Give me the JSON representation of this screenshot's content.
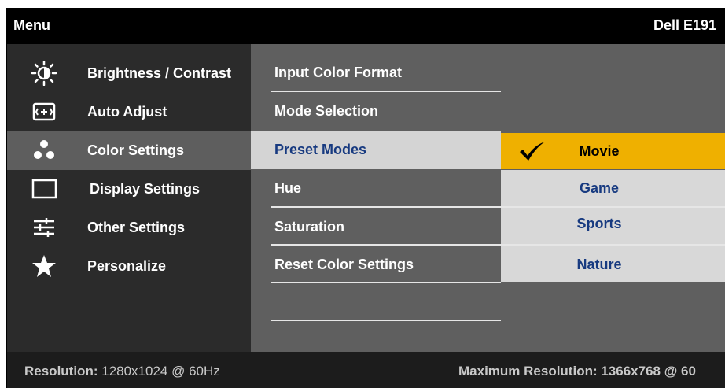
{
  "header": {
    "menu_title": "Menu",
    "model": "Dell E191"
  },
  "left_menu": [
    {
      "label": "Brightness / Contrast",
      "icon": "brightness-icon"
    },
    {
      "label": "Auto Adjust",
      "icon": "auto-adjust-icon"
    },
    {
      "label": "Color Settings",
      "icon": "color-settings-icon",
      "selected": true
    },
    {
      "label": "Display Settings",
      "icon": "display-icon"
    },
    {
      "label": "Other Settings",
      "icon": "sliders-icon"
    },
    {
      "label": "Personalize",
      "icon": "star-icon"
    }
  ],
  "color_menu": [
    {
      "label": "Input Color Format"
    },
    {
      "label": "Mode Selection"
    },
    {
      "label": "Preset Modes",
      "selected": true
    },
    {
      "label": "Hue"
    },
    {
      "label": "Saturation"
    },
    {
      "label": "Reset Color Settings"
    }
  ],
  "preset_options": [
    {
      "label": "Movie",
      "selected": true
    },
    {
      "label": "Game"
    },
    {
      "label": "Sports"
    },
    {
      "label": "Nature"
    }
  ],
  "footer": {
    "resolution_label": "Resolution:",
    "resolution_value": "1280x1024 @ 60Hz",
    "max_resolution": "Maximum Resolution: 1366x768 @ 60"
  },
  "colors": {
    "selected_option": "#efb000",
    "selected_row": "#d4d4d4",
    "option_text": "#173a80"
  }
}
